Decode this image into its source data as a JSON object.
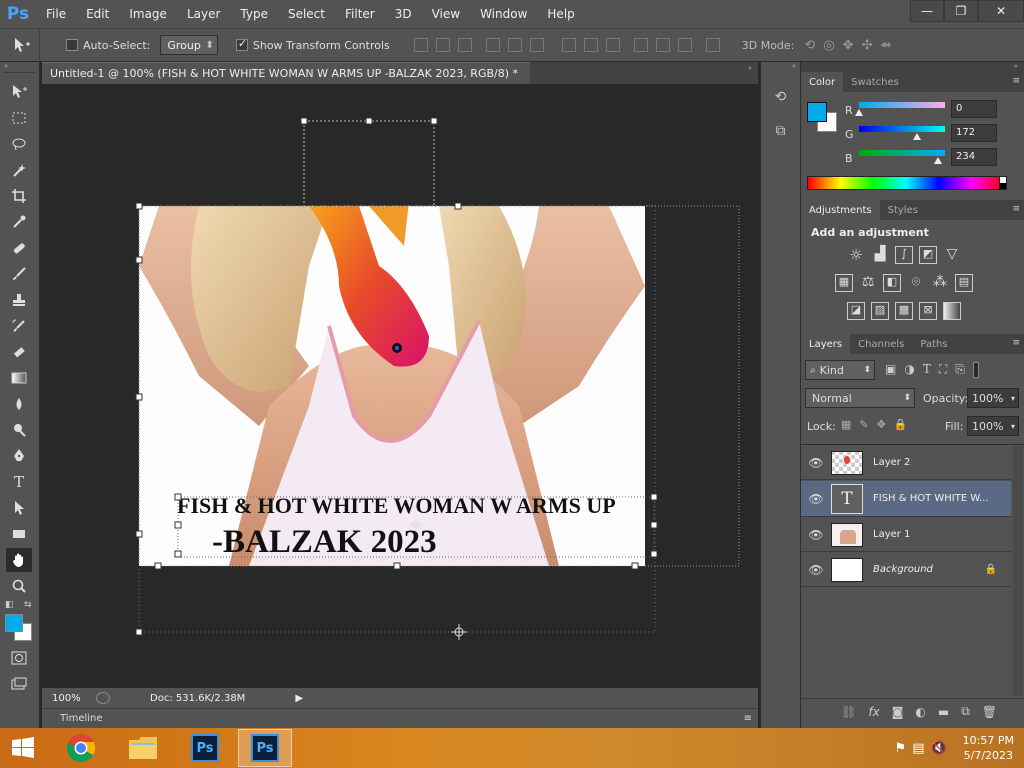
{
  "app": {
    "logo": "Ps"
  },
  "menu": [
    "File",
    "Edit",
    "Image",
    "Layer",
    "Type",
    "Select",
    "Filter",
    "3D",
    "View",
    "Window",
    "Help"
  ],
  "window_controls": {
    "minimize": "—",
    "restore": "❐",
    "close": "✕"
  },
  "options": {
    "auto_select_label": "Auto-Select:",
    "auto_select_checked": false,
    "group_value": "Group",
    "show_transform_label": "Show Transform Controls",
    "show_transform_checked": true,
    "mode_3d_label": "3D Mode:"
  },
  "document": {
    "tab_title": "Untitled-1 @ 100% (FISH & HOT WHITE WOMAN W ARMS UP  -BALZAK 2023, RGB/8) *",
    "text_line1": "FISH & HOT WHITE WOMAN W ARMS UP",
    "text_line2": "-BALZAK 2023"
  },
  "status": {
    "zoom": "100%",
    "doc": "Doc: 531.6K/2.38M"
  },
  "timeline": {
    "label": "Timeline"
  },
  "color_panel": {
    "tabs": [
      "Color",
      "Swatches"
    ],
    "r_label": "R",
    "r_value": "0",
    "r_fraction": 0.0,
    "g_label": "G",
    "g_value": "172",
    "g_fraction": 0.675,
    "b_label": "B",
    "b_value": "234",
    "b_fraction": 0.918,
    "foreground": "#00ACEA",
    "background": "#FFFFFF"
  },
  "adjustments_panel": {
    "tabs": [
      "Adjustments",
      "Styles"
    ],
    "heading": "Add an adjustment"
  },
  "layers_panel": {
    "tabs": [
      "Layers",
      "Channels",
      "Paths"
    ],
    "kind_label": "Kind",
    "blend_mode": "Normal",
    "opacity_label": "Opacity:",
    "opacity_value": "100%",
    "lock_label": "Lock:",
    "fill_label": "Fill:",
    "fill_value": "100%",
    "layers": [
      {
        "name": "Layer 2",
        "type": "pixel"
      },
      {
        "name": "FISH & HOT WHITE W...",
        "type": "text"
      },
      {
        "name": "Layer 1",
        "type": "pixel"
      },
      {
        "name": "Background",
        "type": "background"
      }
    ]
  },
  "taskbar": {
    "time": "10:57 PM",
    "date": "5/7/2023",
    "ps_label": "Ps"
  },
  "colors": {
    "ui_dark": "#535353",
    "canvas_bg": "#282828",
    "selected_layer": "#5b6a84",
    "accent": "#00ACEA"
  }
}
